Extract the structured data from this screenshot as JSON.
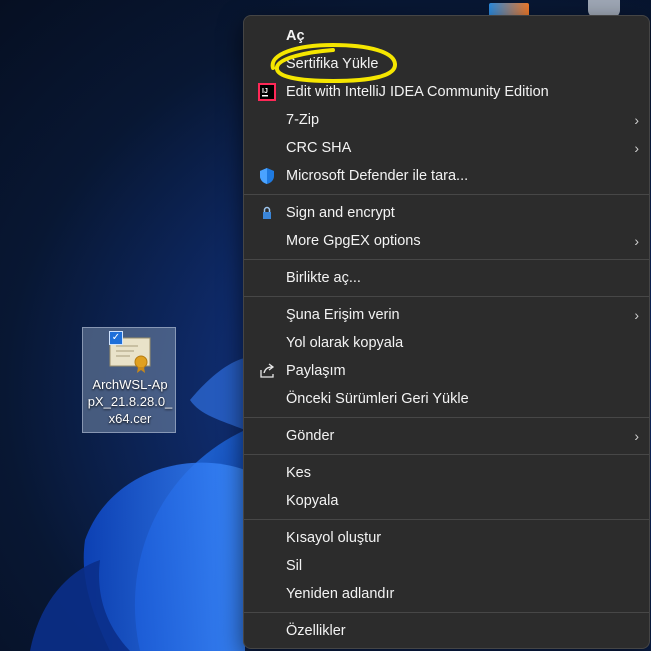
{
  "desktop": {
    "file_name": "ArchWSL-Ap\npX_21.8.28.0_\nx64.cer"
  },
  "menu": {
    "items": [
      {
        "label": "Aç"
      },
      {
        "label": "Sertifika Yükle"
      },
      {
        "label": "Edit with IntelliJ IDEA Community Edition",
        "icon": "intellij-icon"
      },
      {
        "label": "7-Zip"
      },
      {
        "label": "CRC SHA"
      },
      {
        "label": "Microsoft Defender ile tara...",
        "icon": "defender-shield-icon"
      },
      {
        "label": "Sign and encrypt",
        "icon": "gpg-lock-icon"
      },
      {
        "label": "More GpgEX options"
      },
      {
        "label": "Birlikte aç..."
      },
      {
        "label": "Şuna Erişim verin"
      },
      {
        "label": "Yol olarak kopyala"
      },
      {
        "label": "Paylaşım",
        "icon": "share-icon"
      },
      {
        "label": "Önceki Sürümleri Geri Yükle"
      },
      {
        "label": "Gönder"
      },
      {
        "label": "Kes"
      },
      {
        "label": "Kopyala"
      },
      {
        "label": "Kısayol oluştur"
      },
      {
        "label": "Sil"
      },
      {
        "label": "Yeniden adlandır"
      },
      {
        "label": "Özellikler"
      }
    ]
  },
  "colors": {
    "menu_bg": "#2c2c2c",
    "highlight_marker": "#f5e600"
  }
}
